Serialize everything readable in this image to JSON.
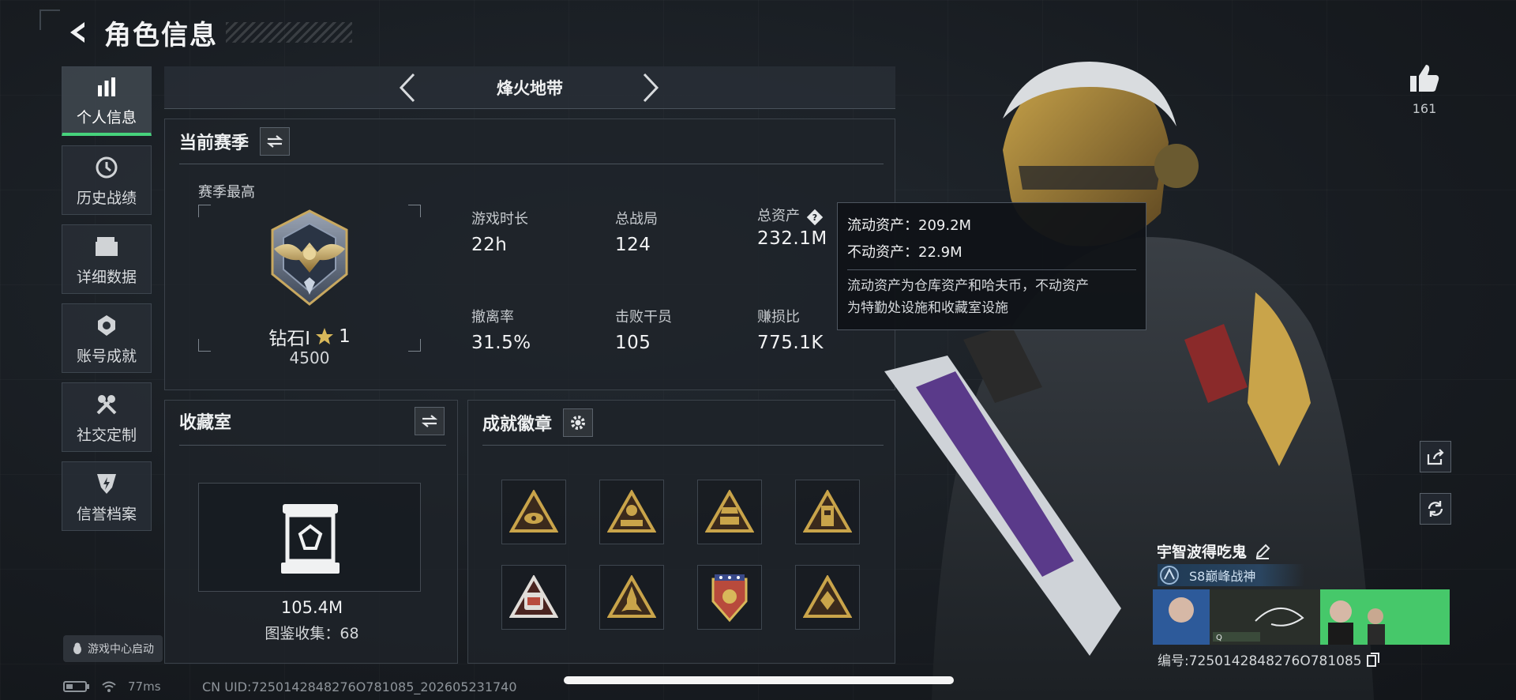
{
  "header": {
    "title": "角色信息"
  },
  "sidebar": {
    "items": [
      {
        "label": "个人信息",
        "icon": "bar-chart-icon",
        "active": true
      },
      {
        "label": "历史战绩",
        "icon": "clock-icon"
      },
      {
        "label": "详细数据",
        "icon": "folder-icon"
      },
      {
        "label": "账号成就",
        "icon": "achievement-icon"
      },
      {
        "label": "社交定制",
        "icon": "tools-icon"
      },
      {
        "label": "信誉档案",
        "icon": "shield-bolt-icon"
      }
    ],
    "launch_label": "游戏中心启动"
  },
  "mode": {
    "name": "烽火地带"
  },
  "season": {
    "title": "当前赛季",
    "best_label": "赛季最高",
    "rank_name": "钻石Ⅰ",
    "rank_stars": "1",
    "rank_points": "4500",
    "stats": [
      {
        "label": "游戏时长",
        "value": "22h"
      },
      {
        "label": "总战局",
        "value": "124"
      },
      {
        "label": "总资产",
        "value": "232.1M"
      },
      {
        "label": "撤离率",
        "value": "31.5%"
      },
      {
        "label": "击败干员",
        "value": "105"
      },
      {
        "label": "赚损比",
        "value": "775.1K"
      }
    ]
  },
  "tooltip": {
    "liquid": "流动资产：209.2M",
    "fixed": "不动资产：22.9M",
    "desc_line1": "流动资产为仓库资产和哈夫币，不动资产",
    "desc_line2": "为特勤处设施和收藏室设施"
  },
  "collection": {
    "title": "收藏室",
    "value": "105.4M",
    "count": "图鉴收集：68"
  },
  "badges": {
    "title": "成就徽章",
    "items": [
      {
        "icon": "badge-triangle-eye-icon",
        "color": "#c9a44a"
      },
      {
        "icon": "badge-triangle-s4-icon",
        "color": "#c9a44a"
      },
      {
        "icon": "badge-triangle-s6-icon",
        "color": "#c9a44a"
      },
      {
        "icon": "badge-triangle-tower-icon",
        "color": "#c9a44a"
      },
      {
        "icon": "badge-triangle-s8-icon",
        "color": "#b84a3c"
      },
      {
        "icon": "badge-triangle-rocket-icon",
        "color": "#c9a44a"
      },
      {
        "icon": "badge-shield-icon",
        "color": "#b84a3c"
      },
      {
        "icon": "badge-triangle-diamond-icon",
        "color": "#c9a44a"
      }
    ]
  },
  "likes": {
    "count": "161"
  },
  "player": {
    "name": "宇智波得吃鬼",
    "title": "S8巅峰战神",
    "card_tag": "Q",
    "uid": "编号:7250142848276O781085"
  },
  "status": {
    "ping": "77ms",
    "cn_uid": "CN UID:7250142848276O781085_202605231740"
  },
  "colors": {
    "accent_green": "#46d27c",
    "gold": "#c9a44a",
    "panel_bg": "#1e2329"
  }
}
